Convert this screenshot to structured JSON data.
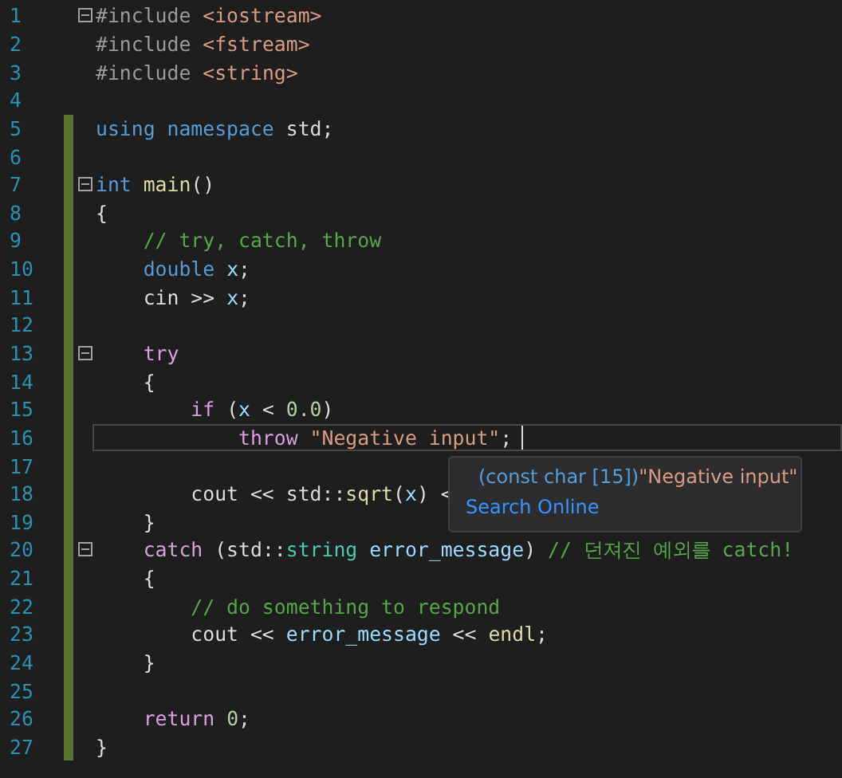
{
  "lines": [
    {
      "number": "1",
      "foldable": true,
      "changed": false,
      "tokens": [
        {
          "kind": "preproc",
          "text": "#include "
        },
        {
          "kind": "string",
          "text": "<iostream>"
        }
      ]
    },
    {
      "number": "2",
      "foldable": false,
      "changed": false,
      "tokens": [
        {
          "kind": "preproc",
          "text": "#include "
        },
        {
          "kind": "string",
          "text": "<fstream>"
        }
      ]
    },
    {
      "number": "3",
      "foldable": false,
      "changed": false,
      "tokens": [
        {
          "kind": "preproc",
          "text": "#include "
        },
        {
          "kind": "string",
          "text": "<string>"
        }
      ]
    },
    {
      "number": "4",
      "foldable": false,
      "changed": false
    },
    {
      "number": "5",
      "foldable": false,
      "changed": true,
      "tokens": [
        {
          "kind": "keyword",
          "text": "using namespace "
        },
        {
          "kind": "plain",
          "text": "std;"
        }
      ]
    },
    {
      "number": "6",
      "foldable": false,
      "changed": true
    },
    {
      "number": "7",
      "foldable": true,
      "changed": true,
      "tokens": [
        {
          "kind": "keyword",
          "text": "int "
        },
        {
          "kind": "func",
          "text": "main"
        },
        {
          "kind": "plain",
          "text": "()"
        }
      ]
    },
    {
      "number": "8",
      "foldable": false,
      "changed": true,
      "tokens": [
        {
          "kind": "plain",
          "text": "{"
        }
      ]
    },
    {
      "number": "9",
      "foldable": false,
      "changed": true,
      "tokens": [
        {
          "kind": "comment",
          "text": "    // try, catch, throw"
        }
      ]
    },
    {
      "number": "10",
      "foldable": false,
      "changed": true,
      "tokens": [
        {
          "kind": "keyword",
          "text": "    double "
        },
        {
          "kind": "var",
          "text": "x"
        },
        {
          "kind": "plain",
          "text": ";"
        }
      ]
    },
    {
      "number": "11",
      "foldable": false,
      "changed": true,
      "tokens": [
        {
          "kind": "plain",
          "text": "    cin >> "
        },
        {
          "kind": "var",
          "text": "x"
        },
        {
          "kind": "plain",
          "text": ";"
        }
      ]
    },
    {
      "number": "12",
      "foldable": false,
      "changed": true
    },
    {
      "number": "13",
      "foldable": true,
      "changed": true,
      "tokens": [
        {
          "kind": "control",
          "text": "    try"
        }
      ]
    },
    {
      "number": "14",
      "foldable": false,
      "changed": true,
      "tokens": [
        {
          "kind": "plain",
          "text": "    {"
        }
      ]
    },
    {
      "number": "15",
      "foldable": false,
      "changed": true,
      "tokens": [
        {
          "kind": "control",
          "text": "        if"
        },
        {
          "kind": "plain",
          "text": " ("
        },
        {
          "kind": "var",
          "text": "x"
        },
        {
          "kind": "plain",
          "text": " < "
        },
        {
          "kind": "number",
          "text": "0.0"
        },
        {
          "kind": "plain",
          "text": ")"
        }
      ]
    },
    {
      "number": "16",
      "foldable": false,
      "changed": true,
      "current": true,
      "tokens": [
        {
          "kind": "control",
          "text": "            throw "
        },
        {
          "kind": "string",
          "text": "\"Negative input\""
        },
        {
          "kind": "plain",
          "text": ";"
        }
      ]
    },
    {
      "number": "17",
      "foldable": false,
      "changed": true
    },
    {
      "number": "18",
      "foldable": false,
      "changed": true,
      "tokens": [
        {
          "kind": "plain",
          "text": "        cout << std::"
        },
        {
          "kind": "func",
          "text": "sqrt"
        },
        {
          "kind": "plain",
          "text": "("
        },
        {
          "kind": "var",
          "text": "x"
        },
        {
          "kind": "plain",
          "text": ") <"
        }
      ]
    },
    {
      "number": "19",
      "foldable": false,
      "changed": true,
      "tokens": [
        {
          "kind": "plain",
          "text": "    }"
        }
      ]
    },
    {
      "number": "20",
      "foldable": true,
      "changed": true,
      "tokens": [
        {
          "kind": "control",
          "text": "    catch"
        },
        {
          "kind": "plain",
          "text": " (std::"
        },
        {
          "kind": "type",
          "text": "string"
        },
        {
          "kind": "var",
          "text": " error_message"
        },
        {
          "kind": "plain",
          "text": ") "
        },
        {
          "kind": "comment",
          "text": "// 던져진 예외를 catch!"
        }
      ]
    },
    {
      "number": "21",
      "foldable": false,
      "changed": true,
      "tokens": [
        {
          "kind": "plain",
          "text": "    {"
        }
      ]
    },
    {
      "number": "22",
      "foldable": false,
      "changed": true,
      "tokens": [
        {
          "kind": "comment",
          "text": "        // do something to respond"
        }
      ]
    },
    {
      "number": "23",
      "foldable": false,
      "changed": true,
      "tokens": [
        {
          "kind": "plain",
          "text": "        cout << "
        },
        {
          "kind": "var",
          "text": "error_message"
        },
        {
          "kind": "plain",
          "text": " << "
        },
        {
          "kind": "func",
          "text": "endl"
        },
        {
          "kind": "plain",
          "text": ";"
        }
      ]
    },
    {
      "number": "24",
      "foldable": false,
      "changed": true,
      "tokens": [
        {
          "kind": "plain",
          "text": "    }"
        }
      ]
    },
    {
      "number": "25",
      "foldable": false,
      "changed": true
    },
    {
      "number": "26",
      "foldable": false,
      "changed": true,
      "tokens": [
        {
          "kind": "control",
          "text": "    return "
        },
        {
          "kind": "number",
          "text": "0"
        },
        {
          "kind": "plain",
          "text": ";"
        }
      ]
    },
    {
      "number": "27",
      "foldable": false,
      "changed": true,
      "tokens": [
        {
          "kind": "plain",
          "text": "}"
        }
      ]
    }
  ],
  "tooltip": {
    "signature": "(const char [15])",
    "value": "\"Negative input\"",
    "link": "Search Online"
  }
}
